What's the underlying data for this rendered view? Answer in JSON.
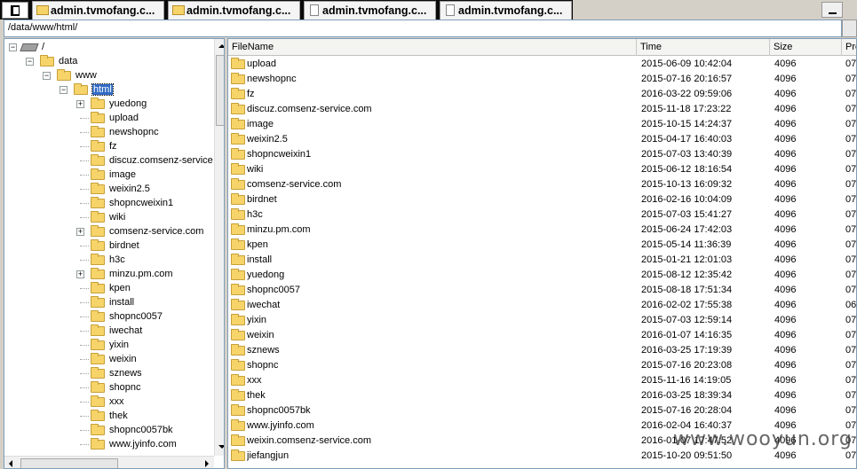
{
  "tabs": [
    {
      "label": "admin.tvmofang.c...",
      "icon": "folder-icon"
    },
    {
      "label": "admin.tvmofang.c...",
      "icon": "folder-icon"
    },
    {
      "label": "admin.tvmofang.c...",
      "icon": "document-icon"
    },
    {
      "label": "admin.tvmofang.c...",
      "icon": "document-icon"
    }
  ],
  "path": "/data/www/html/",
  "tree": [
    {
      "label": "/",
      "level": 0,
      "expander": "-",
      "icon": "drive-icon"
    },
    {
      "label": "data",
      "level": 1,
      "expander": "-",
      "icon": "folder-icon"
    },
    {
      "label": "www",
      "level": 2,
      "expander": "-",
      "icon": "folder-icon"
    },
    {
      "label": "html",
      "level": 3,
      "expander": "-",
      "icon": "folder-open-icon",
      "selected": true
    },
    {
      "label": "yuedong",
      "level": 4,
      "expander": "+",
      "icon": "folder-icon"
    },
    {
      "label": "upload",
      "level": 4,
      "expander": "",
      "icon": "folder-icon"
    },
    {
      "label": "newshopnc",
      "level": 4,
      "expander": "",
      "icon": "folder-icon"
    },
    {
      "label": "fz",
      "level": 4,
      "expander": "",
      "icon": "folder-icon"
    },
    {
      "label": "discuz.comsenz-service",
      "level": 4,
      "expander": "",
      "icon": "folder-icon"
    },
    {
      "label": "image",
      "level": 4,
      "expander": "",
      "icon": "folder-icon"
    },
    {
      "label": "weixin2.5",
      "level": 4,
      "expander": "",
      "icon": "folder-icon"
    },
    {
      "label": "shopncweixin1",
      "level": 4,
      "expander": "",
      "icon": "folder-icon"
    },
    {
      "label": "wiki",
      "level": 4,
      "expander": "",
      "icon": "folder-icon"
    },
    {
      "label": "comsenz-service.com",
      "level": 4,
      "expander": "+",
      "icon": "folder-icon"
    },
    {
      "label": "birdnet",
      "level": 4,
      "expander": "",
      "icon": "folder-icon"
    },
    {
      "label": "h3c",
      "level": 4,
      "expander": "",
      "icon": "folder-icon"
    },
    {
      "label": "minzu.pm.com",
      "level": 4,
      "expander": "+",
      "icon": "folder-icon"
    },
    {
      "label": "kpen",
      "level": 4,
      "expander": "",
      "icon": "folder-icon"
    },
    {
      "label": "install",
      "level": 4,
      "expander": "",
      "icon": "folder-icon"
    },
    {
      "label": "shopnc0057",
      "level": 4,
      "expander": "",
      "icon": "folder-icon"
    },
    {
      "label": "iwechat",
      "level": 4,
      "expander": "",
      "icon": "folder-icon"
    },
    {
      "label": "yixin",
      "level": 4,
      "expander": "",
      "icon": "folder-icon"
    },
    {
      "label": "weixin",
      "level": 4,
      "expander": "",
      "icon": "folder-icon"
    },
    {
      "label": "sznews",
      "level": 4,
      "expander": "",
      "icon": "folder-icon"
    },
    {
      "label": "shopnc",
      "level": 4,
      "expander": "",
      "icon": "folder-icon"
    },
    {
      "label": "xxx",
      "level": 4,
      "expander": "",
      "icon": "folder-icon"
    },
    {
      "label": "thek",
      "level": 4,
      "expander": "",
      "icon": "folder-icon"
    },
    {
      "label": "shopnc0057bk",
      "level": 4,
      "expander": "",
      "icon": "folder-icon"
    },
    {
      "label": "www.jyinfo.com",
      "level": 4,
      "expander": "",
      "icon": "folder-icon"
    }
  ],
  "list": {
    "columns": [
      "FileName",
      "Time",
      "Size",
      "Pro"
    ],
    "rows": [
      {
        "name": "upload",
        "time": "2015-06-09 10:42:04",
        "size": "4096",
        "prop": "07"
      },
      {
        "name": "newshopnc",
        "time": "2015-07-16 20:16:57",
        "size": "4096",
        "prop": "07"
      },
      {
        "name": "fz",
        "time": "2016-03-22 09:59:06",
        "size": "4096",
        "prop": "07"
      },
      {
        "name": "discuz.comsenz-service.com",
        "time": "2015-11-18 17:23:22",
        "size": "4096",
        "prop": "07"
      },
      {
        "name": "image",
        "time": "2015-10-15 14:24:37",
        "size": "4096",
        "prop": "07"
      },
      {
        "name": "weixin2.5",
        "time": "2015-04-17 16:40:03",
        "size": "4096",
        "prop": "07"
      },
      {
        "name": "shopncweixin1",
        "time": "2015-07-03 13:40:39",
        "size": "4096",
        "prop": "07"
      },
      {
        "name": "wiki",
        "time": "2015-06-12 18:16:54",
        "size": "4096",
        "prop": "07"
      },
      {
        "name": "comsenz-service.com",
        "time": "2015-10-13 16:09:32",
        "size": "4096",
        "prop": "07"
      },
      {
        "name": "birdnet",
        "time": "2016-02-16 10:04:09",
        "size": "4096",
        "prop": "07"
      },
      {
        "name": "h3c",
        "time": "2015-07-03 15:41:27",
        "size": "4096",
        "prop": "07"
      },
      {
        "name": "minzu.pm.com",
        "time": "2015-06-24 17:42:03",
        "size": "4096",
        "prop": "07"
      },
      {
        "name": "kpen",
        "time": "2015-05-14 11:36:39",
        "size": "4096",
        "prop": "07"
      },
      {
        "name": "install",
        "time": "2015-01-21 12:01:03",
        "size": "4096",
        "prop": "07"
      },
      {
        "name": "yuedong",
        "time": "2015-08-12 12:35:42",
        "size": "4096",
        "prop": "07"
      },
      {
        "name": "shopnc0057",
        "time": "2015-08-18 17:51:34",
        "size": "4096",
        "prop": "07"
      },
      {
        "name": "iwechat",
        "time": "2016-02-02 17:55:38",
        "size": "4096",
        "prop": "06"
      },
      {
        "name": "yixin",
        "time": "2015-07-03 12:59:14",
        "size": "4096",
        "prop": "07"
      },
      {
        "name": "weixin",
        "time": "2016-01-07 14:16:35",
        "size": "4096",
        "prop": "07"
      },
      {
        "name": "sznews",
        "time": "2016-03-25 17:19:39",
        "size": "4096",
        "prop": "07"
      },
      {
        "name": "shopnc",
        "time": "2015-07-16 20:23:08",
        "size": "4096",
        "prop": "07"
      },
      {
        "name": "xxx",
        "time": "2015-11-16 14:19:05",
        "size": "4096",
        "prop": "07"
      },
      {
        "name": "thek",
        "time": "2016-03-25 18:39:34",
        "size": "4096",
        "prop": "07"
      },
      {
        "name": "shopnc0057bk",
        "time": "2015-07-16 20:28:04",
        "size": "4096",
        "prop": "07"
      },
      {
        "name": "www.jyinfo.com",
        "time": "2016-02-04 16:40:37",
        "size": "4096",
        "prop": "07"
      },
      {
        "name": "weixin.comsenz-service.com",
        "time": "2016-01-07 17:47:52",
        "size": "4096",
        "prop": "07"
      },
      {
        "name": "jiefangjun",
        "time": "2015-10-20 09:51:50",
        "size": "4096",
        "prop": "07"
      }
    ]
  },
  "watermark": "www.wooyun.org",
  "colors": {
    "selection": "#316ac5",
    "folder": "#f7d46a",
    "border": "#7f9db9"
  }
}
